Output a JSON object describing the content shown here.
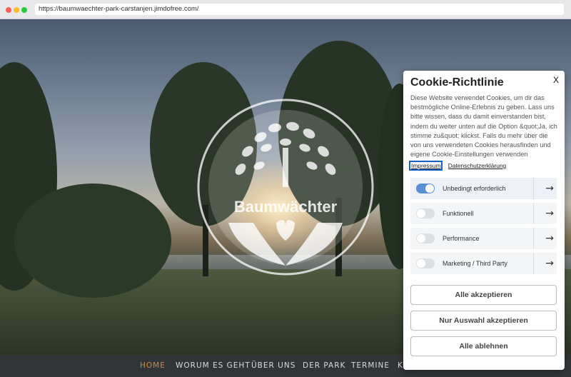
{
  "browser": {
    "url": "https://baumwaechter-park-carstanjen.jimdofree.com/"
  },
  "hero": {
    "logo_text": "Baumwächter"
  },
  "nav": {
    "items": [
      {
        "label": "HOME",
        "active": true
      },
      {
        "label": "WORUM ES GEHT",
        "active": false
      },
      {
        "label": "ÜBER UNS",
        "active": false
      },
      {
        "label": "DER PARK",
        "active": false
      },
      {
        "label": "TERMINE",
        "active": false
      },
      {
        "label": "K",
        "active": false
      }
    ]
  },
  "cookie_modal": {
    "close_label": "X",
    "title": "Cookie-Richtlinie",
    "text": "Diese Website verwendet Cookies, um dir das bestmögliche Online-Erlebnis zu geben. Lass uns bitte wissen, dass du damit einverstanden bist, indem du weiter unten auf die Option &quot;Ja, ich stimme zu&quot; klickst. Falls du mehr über die von uns verwendeten Cookies herausfinden und eigene Cookie-Einstellungen verwenden möchtest, schau",
    "links": {
      "impressum": "Impressum",
      "datenschutz": "Datenschutzerklärung"
    },
    "categories": [
      {
        "label": "Unbedingt erforderlich",
        "enabled": true
      },
      {
        "label": "Funktionell",
        "enabled": false
      },
      {
        "label": "Performance",
        "enabled": false
      },
      {
        "label": "Marketing / Third Party",
        "enabled": false
      }
    ],
    "buttons": {
      "accept_all": "Alle akzeptieren",
      "accept_selection": "Nur Auswahl akzeptieren",
      "reject_all": "Alle ablehnen"
    }
  },
  "colors": {
    "nav_active": "#c98a4a",
    "toggle_on": "#5a8fd6",
    "focus_outline": "#1a5ec7"
  }
}
